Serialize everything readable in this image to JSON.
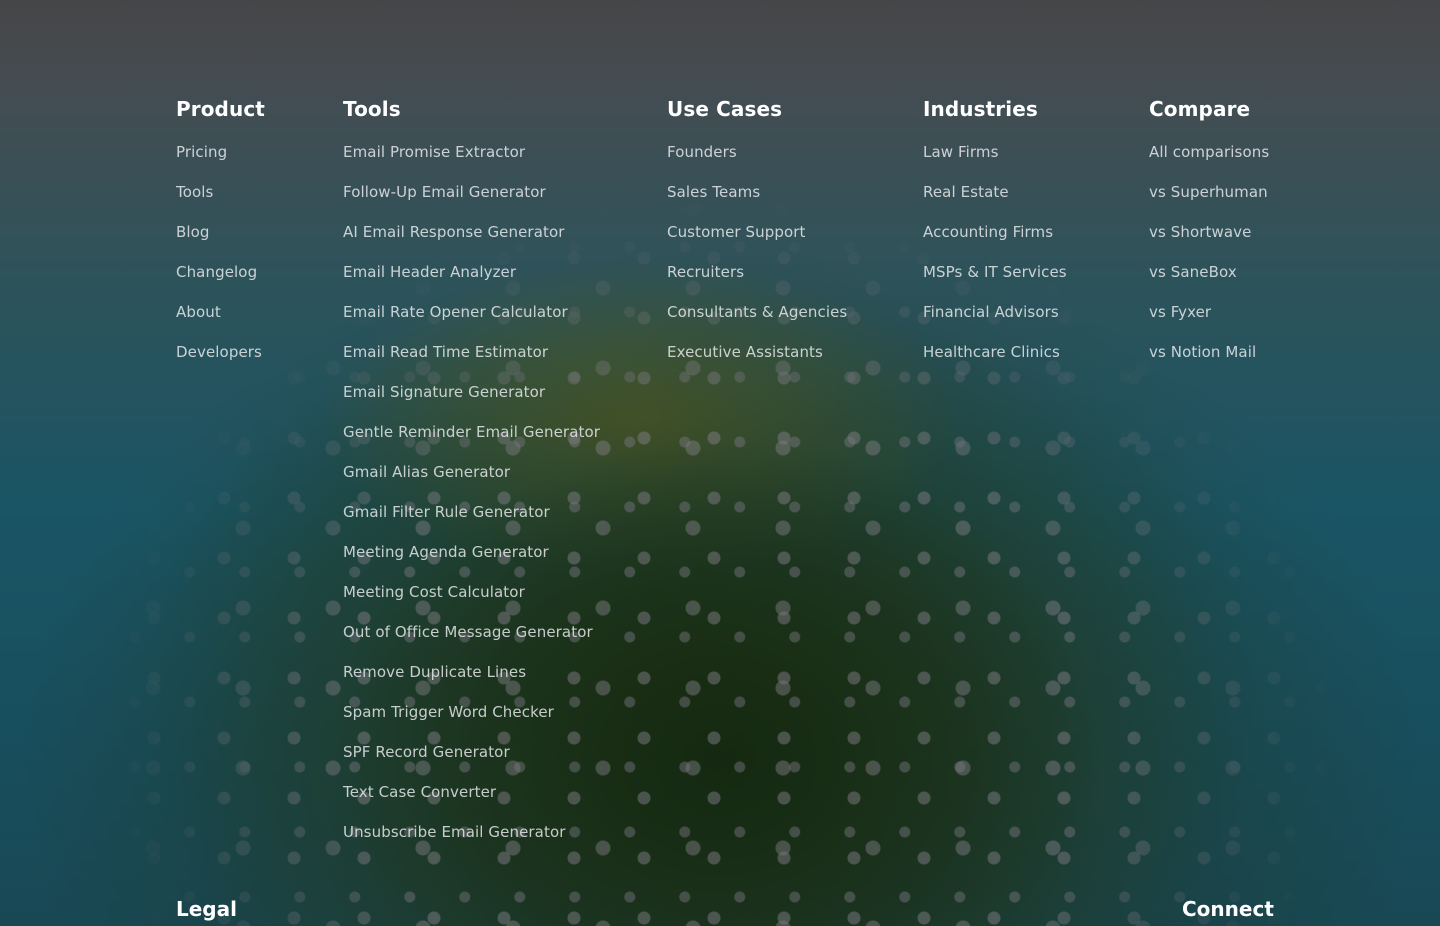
{
  "columns": {
    "product": {
      "heading": "Product",
      "links": [
        "Pricing",
        "Tools",
        "Blog",
        "Changelog",
        "About",
        "Developers"
      ]
    },
    "tools": {
      "heading": "Tools",
      "links": [
        "Email Promise Extractor",
        "Follow-Up Email Generator",
        "AI Email Response Generator",
        "Email Header Analyzer",
        "Email Rate Opener Calculator",
        "Email Read Time Estimator",
        "Email Signature Generator",
        "Gentle Reminder Email Generator",
        "Gmail Alias Generator",
        "Gmail Filter Rule Generator",
        "Meeting Agenda Generator",
        "Meeting Cost Calculator",
        "Out of Office Message Generator",
        "Remove Duplicate Lines",
        "Spam Trigger Word Checker",
        "SPF Record Generator",
        "Text Case Converter",
        "Unsubscribe Email Generator"
      ]
    },
    "use_cases": {
      "heading": "Use Cases",
      "links": [
        "Founders",
        "Sales Teams",
        "Customer Support",
        "Recruiters",
        "Consultants & Agencies",
        "Executive Assistants"
      ]
    },
    "industries": {
      "heading": "Industries",
      "links": [
        "Law Firms",
        "Real Estate",
        "Accounting Firms",
        "MSPs & IT Services",
        "Financial Advisors",
        "Healthcare Clinics"
      ]
    },
    "compare": {
      "heading": "Compare",
      "links": [
        "All comparisons",
        "vs Superhuman",
        "vs Shortwave",
        "vs SaneBox",
        "vs Fyxer",
        "vs Notion Mail"
      ]
    }
  },
  "legal": {
    "heading": "Legal"
  },
  "connect": {
    "heading": "Connect"
  }
}
